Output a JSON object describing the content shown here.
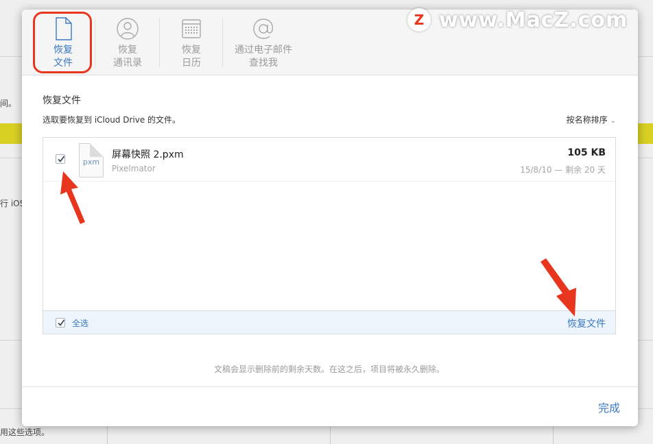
{
  "background": {
    "text_1": "间。",
    "text_2": "行 iOS",
    "text_3": "用这些选项。"
  },
  "toolbar": {
    "tabs": [
      {
        "label_line1": "恢复",
        "label_line2": "文件",
        "icon": "document-icon",
        "active": true
      },
      {
        "label_line1": "恢复",
        "label_line2": "通讯录",
        "icon": "contacts-icon",
        "active": false
      },
      {
        "label_line1": "恢复",
        "label_line2": "日历",
        "icon": "calendar-icon",
        "active": false
      },
      {
        "label_line1": "通过电子邮件",
        "label_line2": "查找我",
        "icon": "at-icon",
        "active": false
      }
    ]
  },
  "content": {
    "title": "恢复文件",
    "subtitle": "选取要恢复到 iCloud Drive 的文件。",
    "sort_label": "按名称排序",
    "files": [
      {
        "name": "屏幕快照 2.pxm",
        "app": "Pixelmator",
        "size": "105 KB",
        "date_remaining": "15/8/10 — 剩余 20 天",
        "ext": "pxm",
        "checked": true
      }
    ],
    "select_all_label": "全选",
    "restore_label": "恢复文件",
    "note": "文稿会显示删除前的剩余天数。在这之后，项目将被永久删除。"
  },
  "footer": {
    "done_label": "完成"
  },
  "watermark": {
    "logo_letter": "Z",
    "text": "www.MacZ.com"
  },
  "colors": {
    "accent": "#3b78c3",
    "annotation_red": "#e8361e",
    "highlight_yellow": "#d9d024"
  }
}
